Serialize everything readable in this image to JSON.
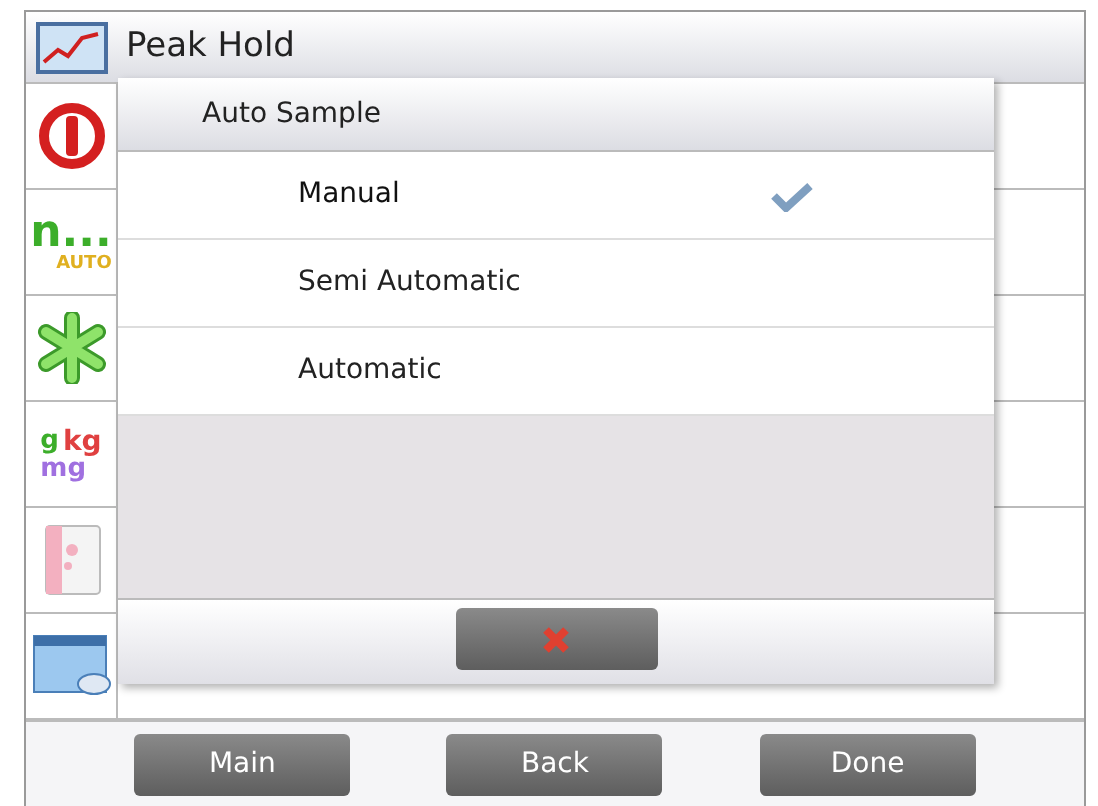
{
  "menu": {
    "header": "Peak Hold",
    "rows": [
      {
        "kind": "power"
      },
      {
        "kind": "auto",
        "texts": [
          "n...",
          "AUTO"
        ]
      },
      {
        "kind": "asterisk"
      },
      {
        "kind": "units",
        "texts": [
          "g",
          "kg",
          "mg"
        ]
      },
      {
        "kind": "book"
      },
      {
        "kind": "print"
      }
    ]
  },
  "dialog": {
    "title": "Auto Sample",
    "options": [
      {
        "label": "Manual",
        "selected": true
      },
      {
        "label": "Semi Automatic",
        "selected": false
      },
      {
        "label": "Automatic",
        "selected": false
      }
    ]
  },
  "buttons": [
    "Main",
    "Back",
    "Done"
  ]
}
